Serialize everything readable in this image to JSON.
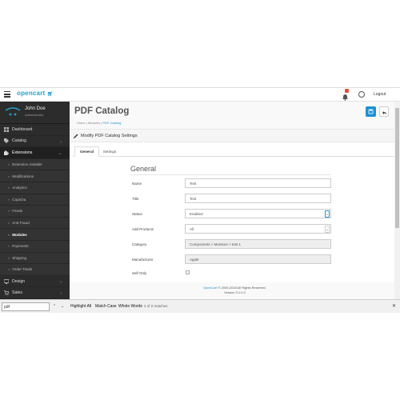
{
  "topbar": {
    "logo": "opencart",
    "logout": "Logout"
  },
  "profile": {
    "name": "John Doe",
    "role": "Administrator"
  },
  "nav": {
    "dashboard": "Dashboard",
    "catalog": "Catalog",
    "extensions": "Extensions",
    "extension_installer": "Extension Installer",
    "modifications": "Modifications",
    "analytics": "Analytics",
    "captcha": "Captcha",
    "feeds": "Feeds",
    "anti_fraud": "Anti-Fraud",
    "modules": "Modules",
    "payments": "Payments",
    "shipping": "Shipping",
    "order_totals": "Order Totals",
    "design": "Design",
    "sales": "Sales"
  },
  "page": {
    "title": "PDF Catalog",
    "breadcrumb": {
      "home": "Home",
      "modules": "Modules",
      "current": "PDF Catalog",
      "sep": "|"
    }
  },
  "panel": {
    "heading": "Modify PDF Catalog Settings",
    "tabs": [
      "General",
      "Settings"
    ],
    "legend": "General"
  },
  "form": {
    "name_label": "Name",
    "name_value": "Test",
    "title_label": "Title",
    "title_value": "Test",
    "status_label": "Status",
    "status_value": "Enabled",
    "add_products_label": "Add Products",
    "add_products_value": "All",
    "category_label": "Category",
    "category_value": "Components > Monitors > test 1",
    "manufacturer_label": "Manufacturer",
    "manufacturer_value": "Apple",
    "self_only_label": "Self Only"
  },
  "footer": {
    "link": "OpenCart",
    "copy": "© 2009-2018 All Rights Reserved.",
    "version": "Version 3.1.0.2"
  },
  "findbar": {
    "query": "pdf",
    "highlight_all": "Highlight All",
    "match_case": "Match Case",
    "whole_words": "Whole Words",
    "count": "2 of 2 matches"
  },
  "colors": {
    "accent": "#1e91cf",
    "sidebar": "#2c2c2c",
    "notification": "#e3503e"
  }
}
